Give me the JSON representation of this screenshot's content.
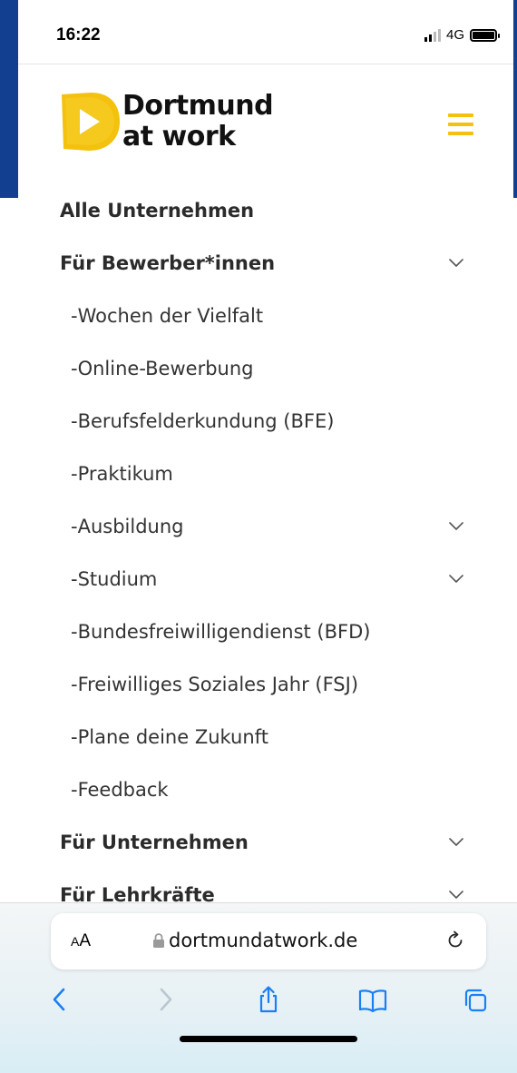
{
  "status_bar": {
    "time": "16:22",
    "network": "4G"
  },
  "header": {
    "logo_line1": "Dortmund",
    "logo_line2": "at work",
    "accent_color": "#f3c10e"
  },
  "menu": {
    "items": [
      {
        "label": "Alle Unternehmen",
        "level": "top",
        "has_chevron": false
      },
      {
        "label": "Für Bewerber*innen",
        "level": "top",
        "has_chevron": true
      },
      {
        "label": "Wochen der Vielfalt",
        "level": "sub",
        "has_chevron": false
      },
      {
        "label": "Online-Bewerbung",
        "level": "sub",
        "has_chevron": false
      },
      {
        "label": "Berufsfelderkundung (BFE)",
        "level": "sub",
        "has_chevron": false
      },
      {
        "label": "Praktikum",
        "level": "sub",
        "has_chevron": false
      },
      {
        "label": "Ausbildung",
        "level": "sub",
        "has_chevron": true
      },
      {
        "label": "Studium",
        "level": "sub",
        "has_chevron": true
      },
      {
        "label": "Bundesfreiwilligendienst (BFD)",
        "level": "sub",
        "has_chevron": false
      },
      {
        "label": "Freiwilliges Soziales Jahr (FSJ)",
        "level": "sub",
        "has_chevron": false
      },
      {
        "label": "Plane deine Zukunft",
        "level": "sub",
        "has_chevron": false
      },
      {
        "label": "Feedback",
        "level": "sub",
        "has_chevron": false
      },
      {
        "label": "Für Unternehmen",
        "level": "top",
        "has_chevron": true
      },
      {
        "label": "Für Lehrkräfte",
        "level": "top",
        "has_chevron": true
      }
    ],
    "sub_prefix": "-"
  },
  "browser": {
    "text_size_label": "AA",
    "url": "dortmundatwork.de",
    "icons": [
      "back-icon",
      "forward-icon",
      "share-icon",
      "bookmarks-icon",
      "tabs-icon",
      "reload-icon",
      "lock-icon"
    ]
  }
}
